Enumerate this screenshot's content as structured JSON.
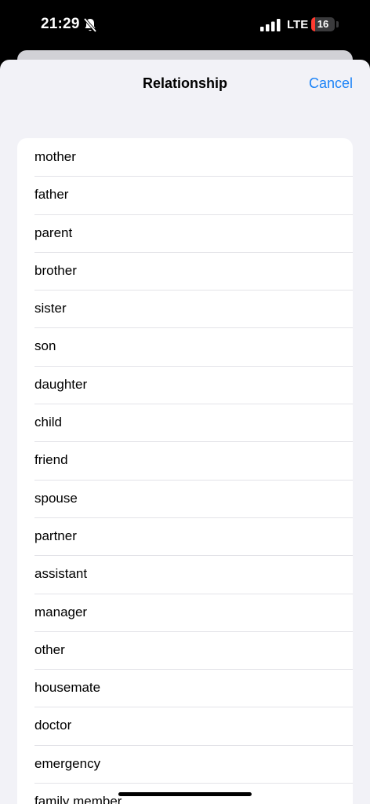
{
  "status_bar": {
    "time": "21:29",
    "network": "LTE",
    "battery_level": "16",
    "battery_fraction": 0.16,
    "icons": [
      "bell-slash-icon",
      "cellular-signal-icon",
      "battery-icon"
    ]
  },
  "sheet": {
    "title": "Relationship",
    "cancel_label": "Cancel"
  },
  "relationships": [
    "mother",
    "father",
    "parent",
    "brother",
    "sister",
    "son",
    "daughter",
    "child",
    "friend",
    "spouse",
    "partner",
    "assistant",
    "manager",
    "other",
    "housemate",
    "doctor",
    "emergency",
    "family member"
  ],
  "colors": {
    "accent": "#1a82f7",
    "sheet_background": "#f2f2f7",
    "battery_low": "#ff3b30"
  }
}
